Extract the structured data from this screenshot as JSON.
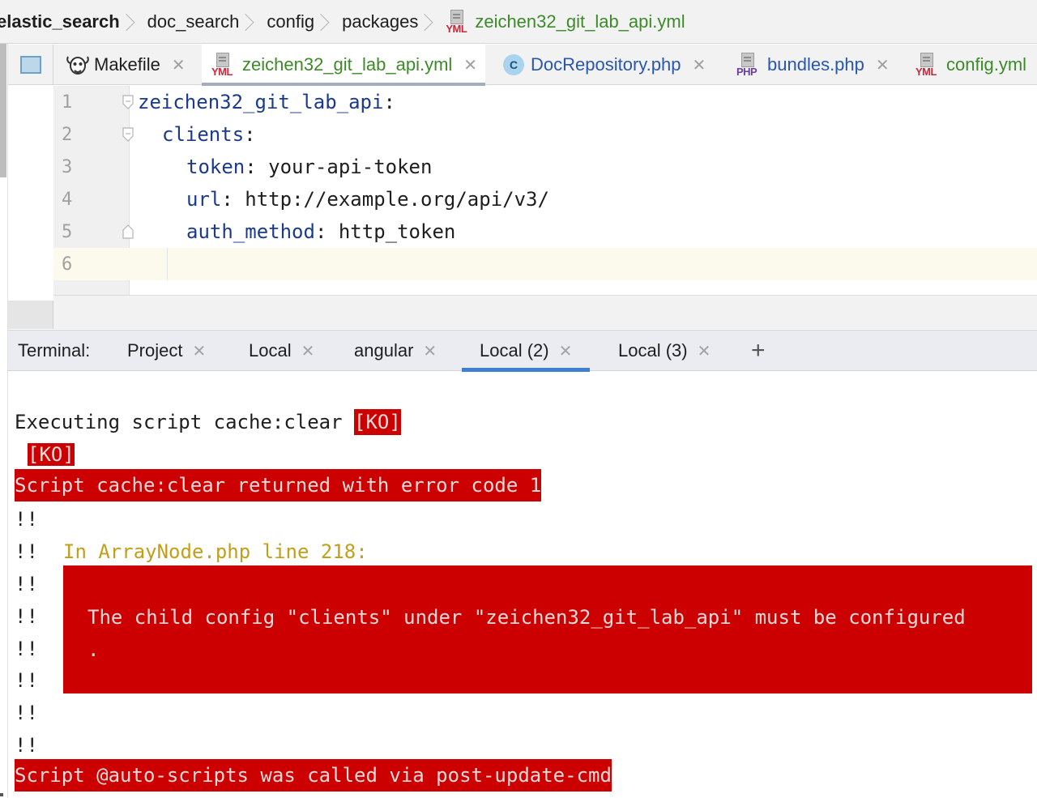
{
  "breadcrumb": {
    "items": [
      "elastic_search",
      "doc_search",
      "config",
      "packages"
    ],
    "current": "zeichen32_git_lab_api.yml"
  },
  "tabs": [
    {
      "label": "Makefile",
      "icon": "gnu-icon",
      "active": false
    },
    {
      "label": "zeichen32_git_lab_api.yml",
      "icon": "yml-file-icon",
      "active": true
    },
    {
      "label": "DocRepository.php",
      "icon": "php-class-icon",
      "active": false
    },
    {
      "label": "bundles.php",
      "icon": "php-file-icon",
      "active": false
    },
    {
      "label": "config.yml",
      "icon": "yml-file-icon",
      "active": false
    }
  ],
  "file_icon_tags": {
    "yml": "YML",
    "php": "PHP",
    "class": "C"
  },
  "editor": {
    "line_numbers": [
      "1",
      "2",
      "3",
      "4",
      "5",
      "6"
    ],
    "lines": [
      {
        "key": "zeichen32_git_lab_api",
        "sep": ":",
        "value": ""
      },
      {
        "key": "clients",
        "sep": ":",
        "value": ""
      },
      {
        "key": "token",
        "sep": ": ",
        "value": "your-api-token"
      },
      {
        "key": "url",
        "sep": ": ",
        "value": "http://example.org/api/v3/"
      },
      {
        "key": "auth_method",
        "sep": ": ",
        "value": "http_token"
      },
      {
        "key": "",
        "sep": "",
        "value": ""
      }
    ]
  },
  "terminal": {
    "title": "Terminal:",
    "tabs": [
      {
        "label": "Project",
        "active": false
      },
      {
        "label": "Local",
        "active": false
      },
      {
        "label": "angular",
        "active": false
      },
      {
        "label": "Local (2)",
        "active": true
      },
      {
        "label": "Local (3)",
        "active": false
      }
    ],
    "add_label": "+",
    "output": {
      "exec_prefix": "Executing script cache:clear ",
      "ko_badge": "[KO]",
      "ko_line": "[KO]",
      "error_code_line": "Script cache:clear returned with error code 1",
      "bang": "!!",
      "in_file_line": "In ArrayNode.php line 218:",
      "error_message": "The child config \"clients\" under \"zeichen32_git_lab_api\" must be configured",
      "error_message_cont": ".",
      "auto_scripts_line": "Script @auto-scripts was called via post-update-cmd"
    }
  },
  "colors": {
    "error_bg": "#cc0000",
    "warning_text": "#c29f1a",
    "active_tab_text": "#3d8a29",
    "yaml_key": "#1b3a8c",
    "active_terminal_underline": "#3f7fd0"
  }
}
